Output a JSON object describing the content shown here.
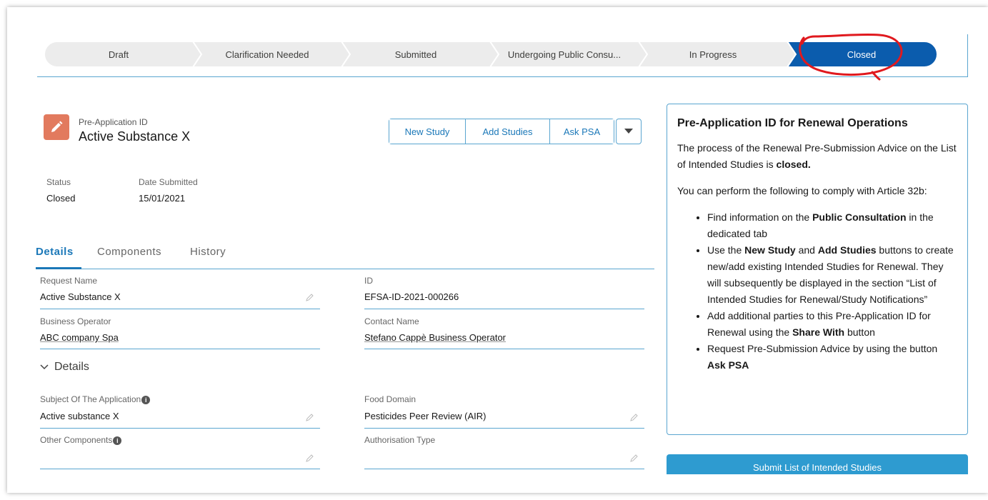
{
  "path": {
    "stages": [
      "Draft",
      "Clarification Needed",
      "Submitted",
      "Undergoing Public Consu...",
      "In Progress",
      "Closed"
    ],
    "active_index": 5,
    "active_color": "#0b5cad"
  },
  "record": {
    "type_label": "Pre-Application ID",
    "title": "Active Substance X",
    "icon": "pencil-icon",
    "icon_color": "#e27a5e"
  },
  "actions": {
    "new_study": "New Study",
    "add_studies": "Add Studies",
    "ask_psa": "Ask PSA"
  },
  "highlights": {
    "status_label": "Status",
    "status_value": "Closed",
    "date_label": "Date Submitted",
    "date_value": "15/01/2021"
  },
  "tabs": [
    "Details",
    "Components",
    "History"
  ],
  "fields": {
    "request_name_label": "Request Name",
    "request_name_value": "Active Substance X",
    "id_label": "ID",
    "id_value": "EFSA-ID-2021-000266",
    "business_operator_label": "Business Operator",
    "business_operator_value": "ABC company Spa",
    "contact_name_label": "Contact Name",
    "contact_name_value": "Stefano Cappè Business Operator",
    "section_label": "Details",
    "subject_label": "Subject Of The Application",
    "subject_value": "Active substance X",
    "food_domain_label": "Food Domain",
    "food_domain_value": "Pesticides Peer Review (AIR)",
    "other_components_label": "Other Components",
    "authorisation_type_label": "Authorisation Type"
  },
  "panel": {
    "title": "Pre-Application ID for Renewal Operations",
    "p1_text": "The process of the Renewal Pre-Submission Advice on the List of Intended Studies is ",
    "p1_bold": "closed.",
    "p2": "You can perform the following to comply with Article 32b:",
    "b1_pre": "Find information on the ",
    "b1_bold": "Public Consultation",
    "b1_post": " in the dedicated tab",
    "b2_pre": "Use the ",
    "b2_bold1": "New Study",
    "b2_mid": " and ",
    "b2_bold2": "Add Studies",
    "b2_post": " buttons to create new/add existing Intended Studies for Renewal. They will subsequently be displayed in the section “List of Intended Studies for Renewal/Study Notifications”",
    "b3_pre": "Add additional parties to this Pre-Application ID for Renewal using the ",
    "b3_bold": "Share With",
    "b3_post": " button",
    "b4_pre": "Request Pre-Submission Advice by using the button ",
    "b4_bold": "Ask PSA"
  },
  "submit_label": "Submit List of Intended Studies"
}
